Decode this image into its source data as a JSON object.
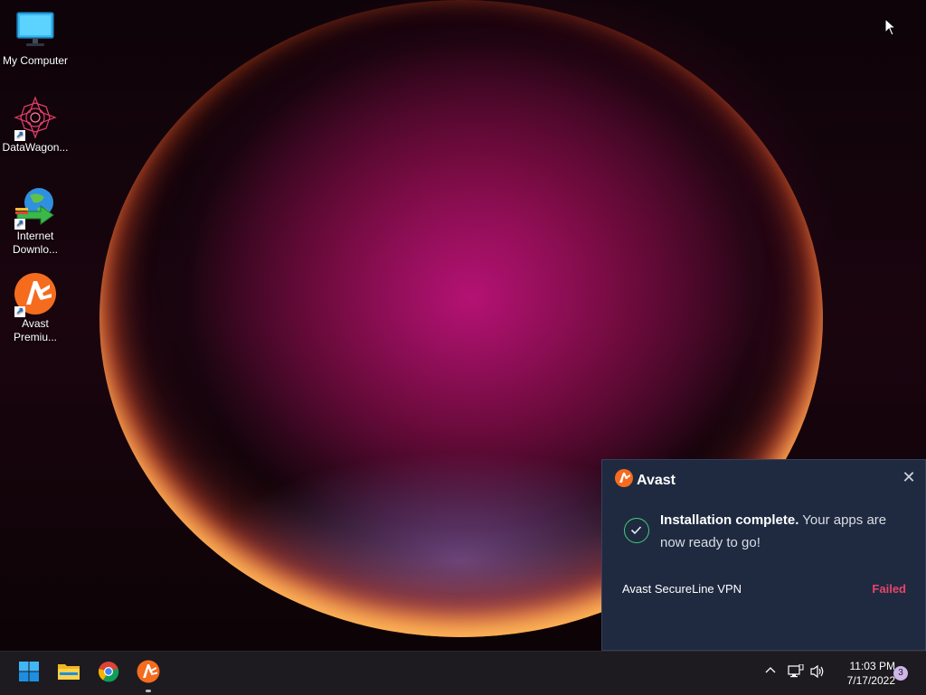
{
  "desktop": {
    "icons": [
      {
        "label": "My Computer"
      },
      {
        "label": "DataWagon..."
      },
      {
        "label": "Internet Downlo..."
      },
      {
        "label": "Avast Premiu..."
      }
    ]
  },
  "notification": {
    "brand": "Avast",
    "message_bold": "Installation complete.",
    "message_rest": " Your apps are now ready to go!",
    "item_name": "Avast SecureLine VPN",
    "item_status": "Failed",
    "close_icon": "close-icon"
  },
  "taskbar": {
    "apps": [
      "start-icon",
      "file-explorer-icon",
      "chrome-icon",
      "avast-icon"
    ],
    "clock_time": "11:03 PM",
    "clock_date": "7/17/2022",
    "notification_count": "3"
  },
  "colors": {
    "accent_orange": "#f56c1e",
    "failed_red": "#e8446b",
    "success_green": "#3fcf7a",
    "toast_bg": "#1f2a40"
  }
}
